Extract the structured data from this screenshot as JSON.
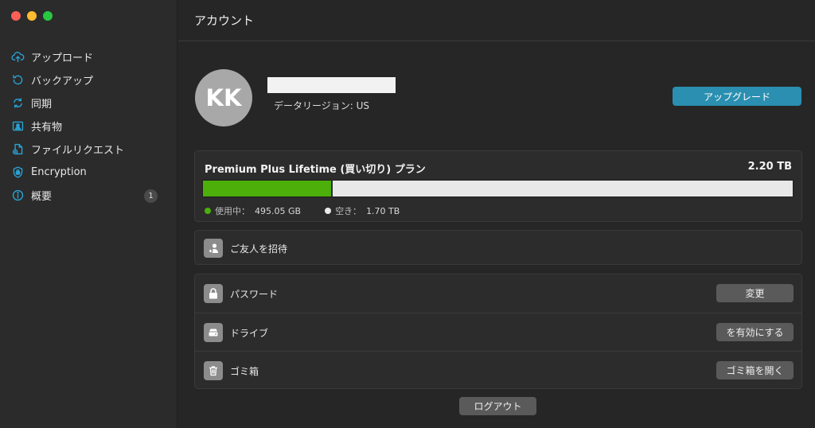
{
  "window": {
    "title": "アカウント"
  },
  "sidebar": {
    "items": [
      {
        "label": "アップロード",
        "icon": "upload-icon"
      },
      {
        "label": "バックアップ",
        "icon": "backup-icon"
      },
      {
        "label": "同期",
        "icon": "sync-icon"
      },
      {
        "label": "共有物",
        "icon": "shared-icon"
      },
      {
        "label": "ファイルリクエスト",
        "icon": "file-request-icon"
      },
      {
        "label": "Encryption",
        "icon": "shield-lock-icon"
      },
      {
        "label": "概要",
        "icon": "info-icon",
        "badge": "1"
      }
    ]
  },
  "profile": {
    "initials": "KK",
    "region": "データリージョン: US",
    "upgrade_label": "アップグレード"
  },
  "plan": {
    "name": "Premium Plus Lifetime (買い切り) プラン",
    "total": "2.20 TB",
    "used_label": "使用中：",
    "used_value": "495.05 GB",
    "free_label": "空き：",
    "free_value": "1.70 TB",
    "used_fraction": 0.22
  },
  "invite": {
    "label": "ご友人を招待"
  },
  "settings": {
    "password": {
      "label": "パスワード",
      "button": "変更"
    },
    "drive": {
      "label": "ドライブ",
      "button": "を有効にする"
    },
    "trash": {
      "label": "ゴミ箱",
      "button": "ゴミ箱を開く"
    }
  },
  "logout_label": "ログアウト",
  "colors": {
    "accent": "#2a8fb0",
    "used": "#4caf0a",
    "sidebar_icon": "#29a3d6"
  }
}
